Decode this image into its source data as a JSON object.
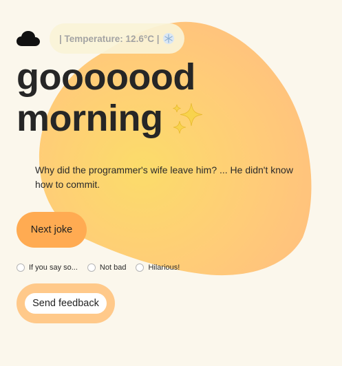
{
  "weather": {
    "condition_icon": "cloud-icon",
    "temperature_text": "| Temperature: 12.6°C |",
    "extra_icon": "snowflake-icon"
  },
  "greeting": {
    "line1": "gooooood",
    "line2": "morning",
    "decoration_icon": "sparkles-icon"
  },
  "joke": {
    "text": "Why did the programmer's wife leave him? ... He didn't know how to commit."
  },
  "actions": {
    "next_label": "Next joke",
    "feedback_label": "Send feedback"
  },
  "rating": {
    "options": [
      "If you say so...",
      "Not bad",
      "Hilarious!"
    ]
  },
  "colors": {
    "background": "#fbf7ec",
    "blob_yellow": "#fbdc6a",
    "blob_orange": "#ffbf7a",
    "next_button": "#ffab52",
    "feedback_ring": "#ffc98a"
  }
}
